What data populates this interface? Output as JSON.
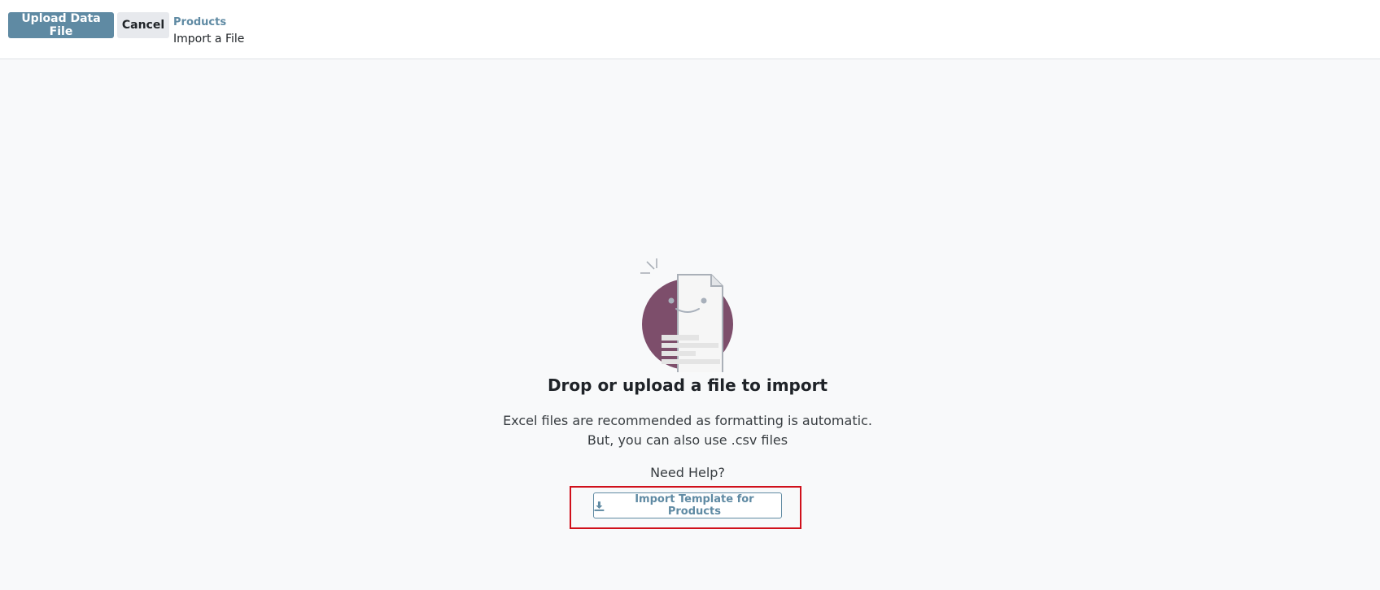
{
  "control_panel": {
    "upload_button_label": "Upload Data File",
    "cancel_button_label": "Cancel",
    "breadcrumb": {
      "parent": "Products",
      "current": "Import a File"
    }
  },
  "dropzone": {
    "title": "Drop or upload a file to import",
    "description_line1": "Excel files are recommended as formatting is automatic.",
    "description_line2": "But, you can also use .csv files",
    "help_text": "Need Help?",
    "template_button_label": "Import Template for Products",
    "template_button_icon": "download-icon"
  },
  "colors": {
    "primary": "#5f8aa3",
    "secondary_button": "#e7e9ed",
    "illustration_circle": "#7d4e6b",
    "highlight_outline": "#d0101b",
    "background": "#f8f9fa"
  }
}
